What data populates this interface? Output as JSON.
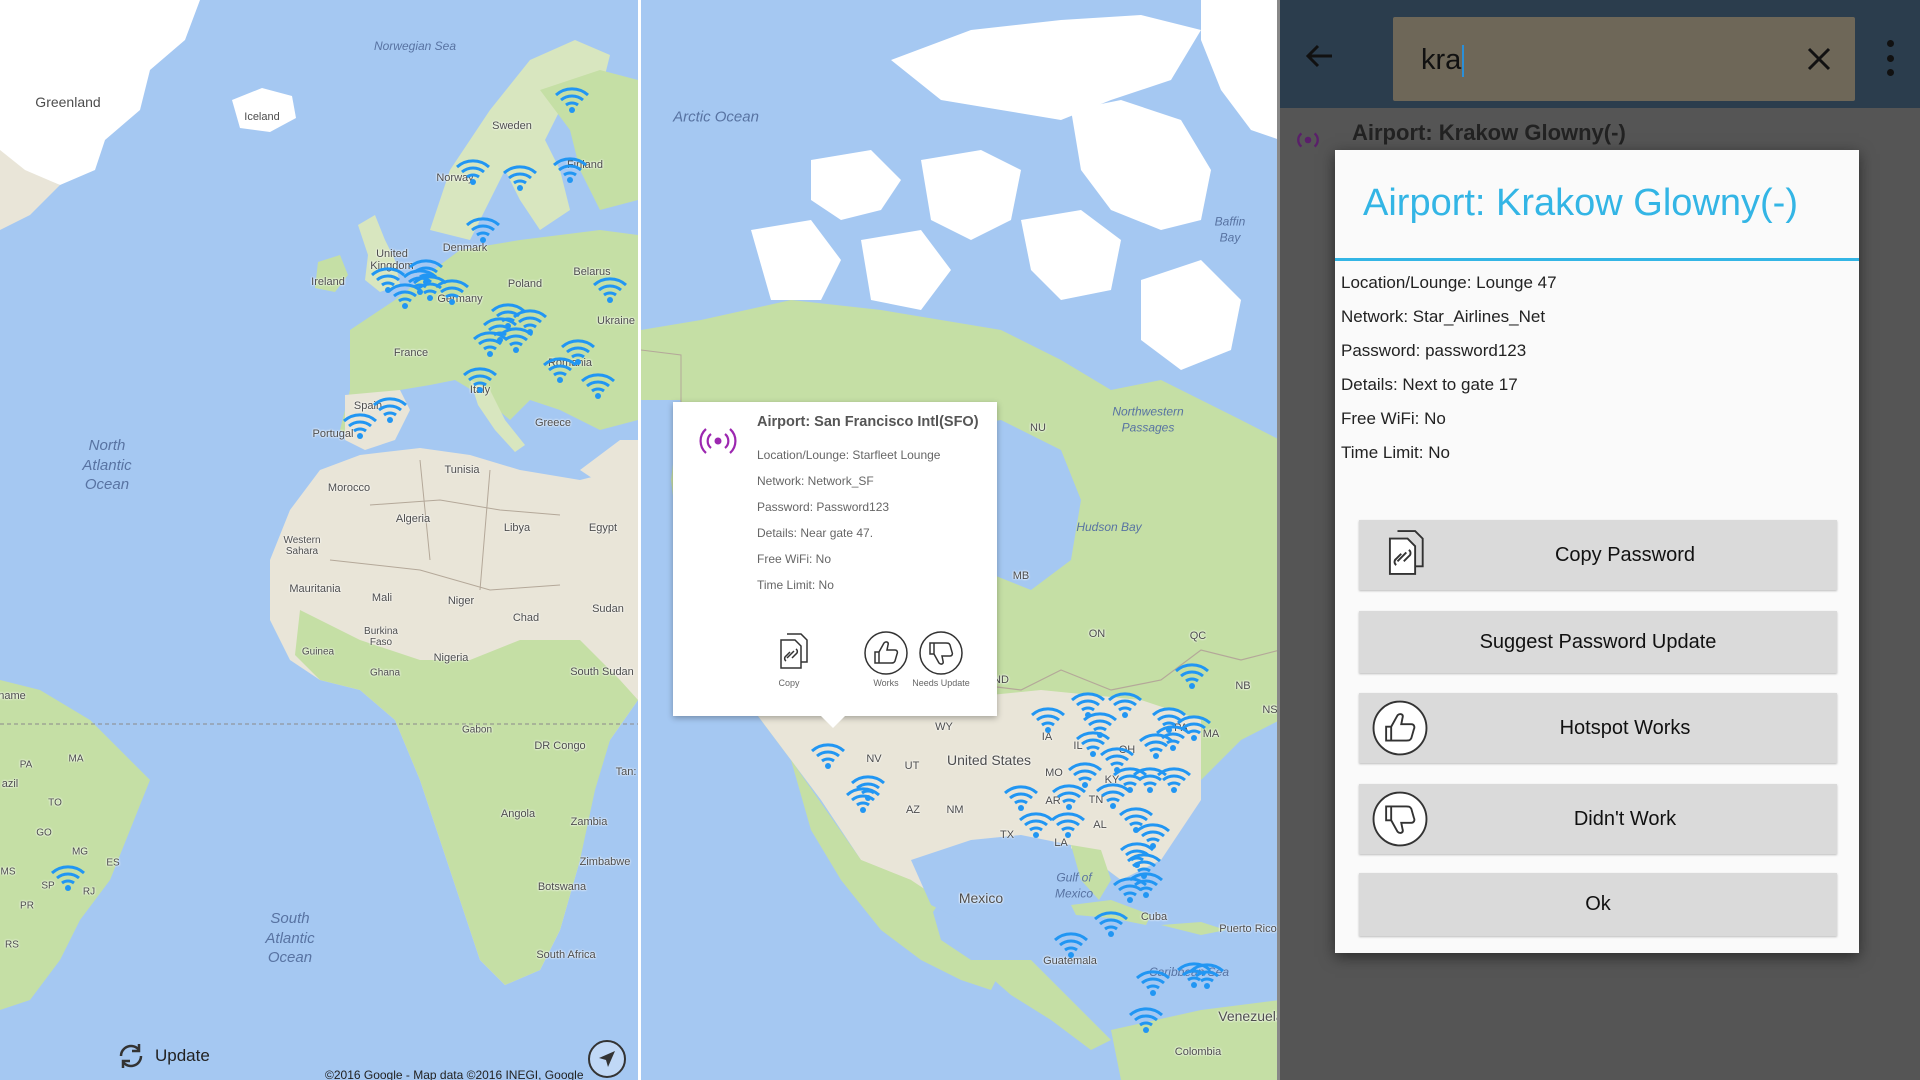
{
  "colors": {
    "water": "#a5c8f2",
    "land": "#e9e5d8",
    "green": "#c5dfa5",
    "wifi": "#2196f3",
    "accent": "#33b5e5",
    "popup_icon": "#9c27b0",
    "toolbar": "#2b3d4d"
  },
  "map_left": {
    "labels": {
      "greenland": "Greenland",
      "iceland": "Iceland",
      "norwegian_sea": "Norwegian Sea",
      "sweden": "Sweden",
      "finland": "Finland",
      "norway": "Norway",
      "denmark": "Denmark",
      "united_kingdom": "United Kingdom",
      "ireland": "Ireland",
      "poland": "Poland",
      "belarus": "Belarus",
      "germany": "Germany",
      "ukraine": "Ukraine",
      "france": "France",
      "romania": "Romania",
      "italy": "Italy",
      "spain": "Spain",
      "portugal": "Portugal",
      "greece": "Greece",
      "north_atlantic": "North Atlantic Ocean",
      "tunisia": "Tunisia",
      "morocco": "Morocco",
      "algeria": "Algeria",
      "libya": "Libya",
      "egypt": "Egypt",
      "western_sahara": "Western Sahara",
      "mauritania": "Mauritania",
      "mali": "Mali",
      "niger": "Niger",
      "chad": "Chad",
      "sudan": "Sudan",
      "burkina_faso": "Burkina Faso",
      "guinea": "Guinea",
      "ghana": "Ghana",
      "nigeria": "Nigeria",
      "south_sudan": "South Sudan",
      "gabon": "Gabon",
      "dr_congo": "DR Congo",
      "tanzania": "Tan:",
      "angola": "Angola",
      "zambia": "Zambia",
      "zimbabwe": "Zimbabwe",
      "botswana": "Botswana",
      "south_africa": "South Africa",
      "south_atlantic": "South Atlantic Ocean",
      "suriname": "name",
      "brazil": "azil",
      "pa": "PA",
      "ma": "MA",
      "to": "TO",
      "go": "GO",
      "mg": "MG",
      "es": "ES",
      "sp": "SP",
      "rj": "RJ",
      "pr": "PR",
      "rs": "RS",
      "ms": "MS"
    },
    "update_label": "Update",
    "copyright": "©2016 Google - Map data ©2016 INEGI, Google"
  },
  "map_center": {
    "labels": {
      "arctic_ocean": "Arctic Ocean",
      "baffin_bay": "Baffin Bay",
      "northwest_passages": "Northwestern Passages",
      "nu": "NU",
      "hudson_bay": "Hudson Bay",
      "mb": "MB",
      "on": "ON",
      "qc": "QC",
      "nb": "NB",
      "ns": "NS",
      "nd": "ND",
      "wy": "WY",
      "ia": "IA",
      "il": "IL",
      "oh": "OH",
      "pa": "PA",
      "ma": "MA",
      "nv": "NV",
      "ut": "UT",
      "united_states": "United States",
      "mo": "MO",
      "ky": "KY",
      "az": "AZ",
      "nm": "NM",
      "ar": "AR",
      "tn": "TN",
      "tx": "TX",
      "la": "LA",
      "al": "AL",
      "mexico": "Mexico",
      "gulf_of_mexico": "Gulf of Mexico",
      "cuba": "Cuba",
      "puerto_rico": "Puerto Rico",
      "guatemala": "Guatemala",
      "caribbean": "Caribbean Sea",
      "venezuela": "Venezuela",
      "colombia": "Colombia"
    },
    "popup": {
      "title": "Airport: San Francisco Intl(SFO)",
      "lines": [
        "Location/Lounge: Starfleet Lounge",
        "Network: Network_SF",
        "Password: Password123",
        "Details: Near gate 47.",
        "Free WiFi: No",
        "Time Limit: No"
      ],
      "actions": {
        "copy": "Copy",
        "works": "Works",
        "needs_update": "Needs Update"
      }
    }
  },
  "app": {
    "search": {
      "value": "kra"
    },
    "result": "Airport: Krakow Glowny(-)",
    "dialog": {
      "title": "Airport: Krakow Glowny(-)",
      "lines": [
        "Location/Lounge: Lounge 47",
        "Network: Star_Airlines_Net",
        "Password: password123",
        "Details: Next to gate 17",
        "Free WiFi: No",
        "Time Limit: No"
      ],
      "buttons": {
        "copy_password": "Copy Password",
        "suggest_update": "Suggest Password Update",
        "hotspot_works": "Hotspot Works",
        "didnt_work": "Didn't Work",
        "ok": "Ok"
      }
    }
  }
}
